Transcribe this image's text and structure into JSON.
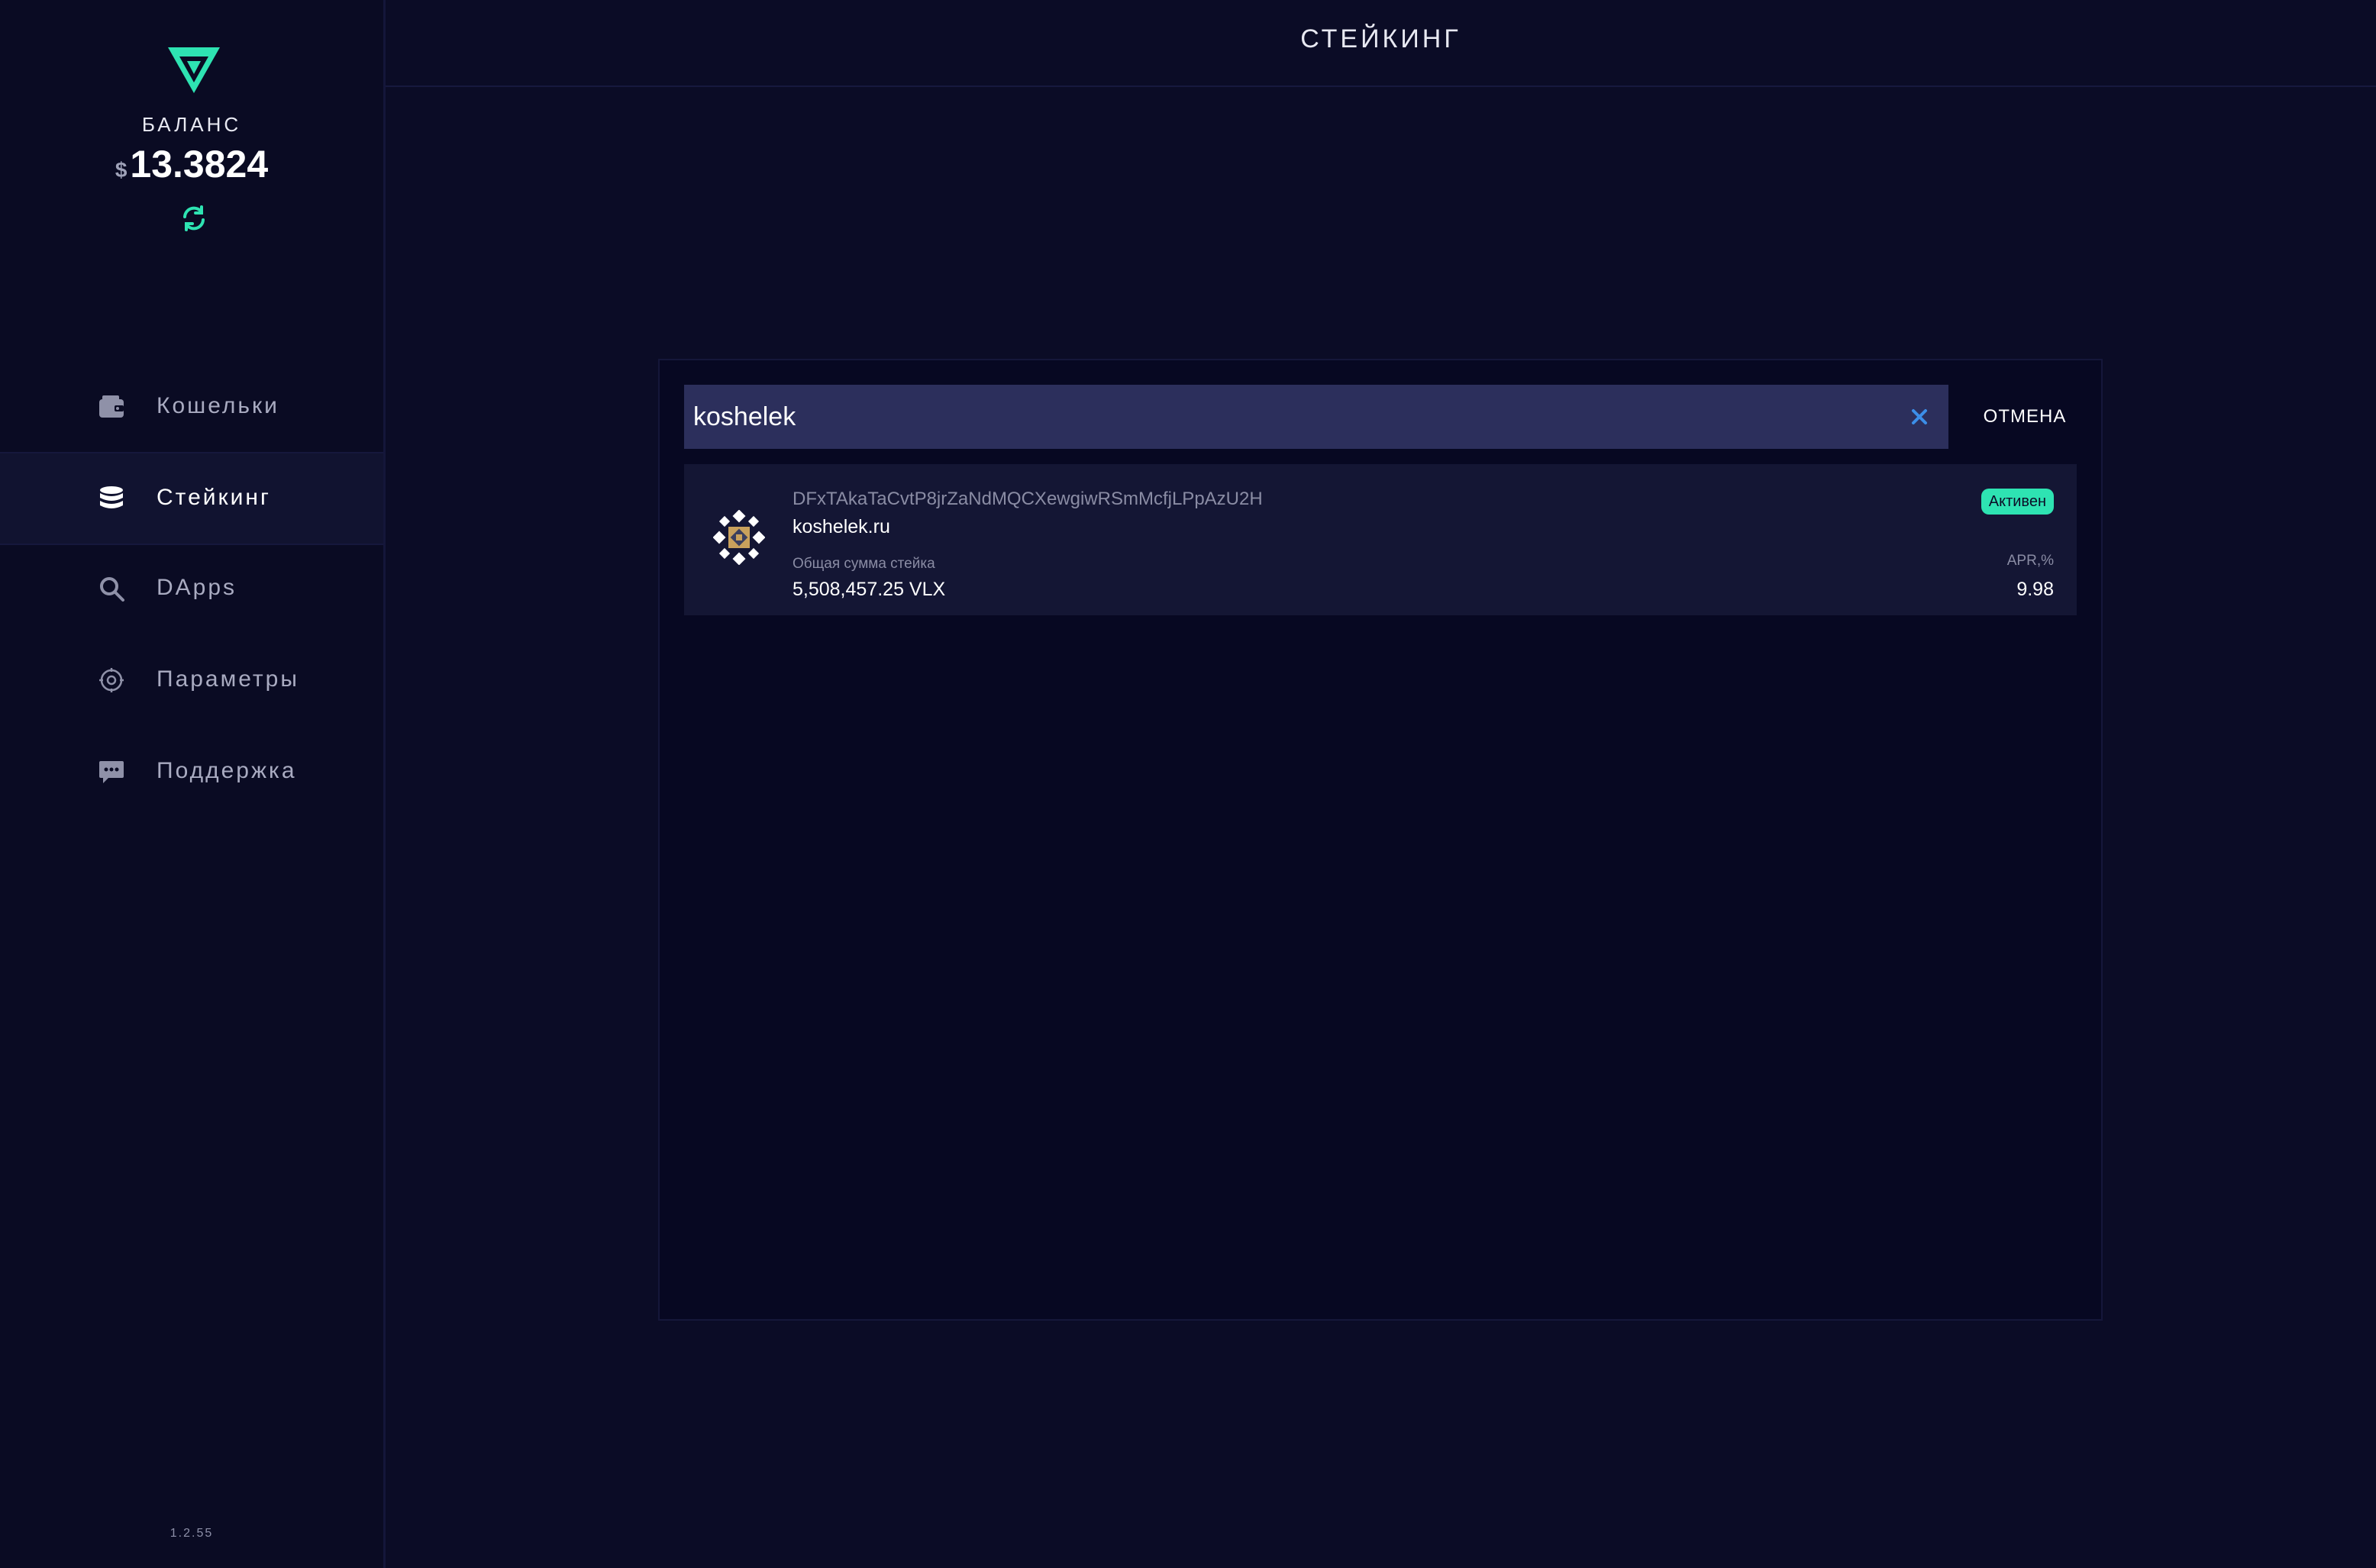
{
  "header": {
    "title": "СТЕЙКИНГ"
  },
  "sidebar": {
    "balance_label": "БАЛАНС",
    "balance_currency": "$",
    "balance_value": "13.3824",
    "version": "1.2.55",
    "items": [
      {
        "label": "Кошельки",
        "icon": "wallet-icon",
        "active": false
      },
      {
        "label": "Стейкинг",
        "icon": "database-icon",
        "active": true
      },
      {
        "label": "DApps",
        "icon": "search-icon",
        "active": false
      },
      {
        "label": "Параметры",
        "icon": "gear-icon",
        "active": false
      },
      {
        "label": "Поддержка",
        "icon": "chat-icon",
        "active": false
      }
    ]
  },
  "search": {
    "value": "koshelek",
    "cancel_label": "ОТМЕНА"
  },
  "result": {
    "address": "DFxTAkaTaCvtP8jrZaNdMQCXewgiwRSmMcfjLPpAzU2H",
    "host": "koshelek.ru",
    "status": "Активен",
    "stake_label": "Общая сумма стейка",
    "stake_value": "5,508,457.25 VLX",
    "apr_label": "APR,%",
    "apr_value": "9.98"
  },
  "colors": {
    "accent": "#2ee3b2",
    "background": "#0b0c26",
    "sidebar": "#0a0b23",
    "card": "#141634",
    "search": "#2c2f5c",
    "clear": "#3c8ee8"
  }
}
